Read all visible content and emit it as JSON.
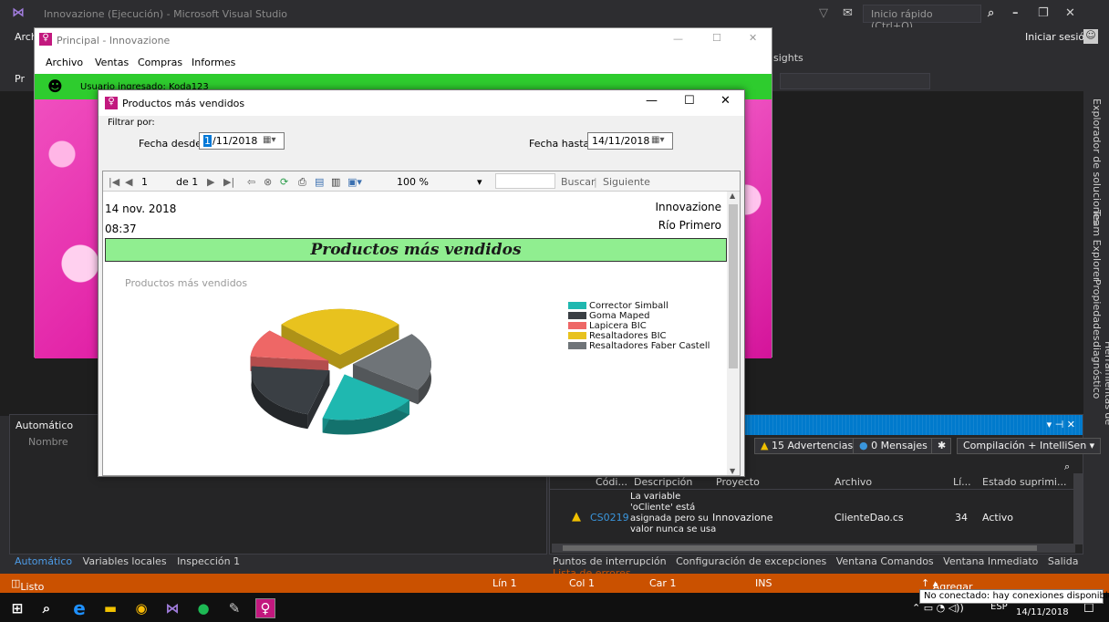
{
  "vs": {
    "title": "Innovazione (Ejecución) - Microsoft Visual Studio",
    "quick_launch": "Inicio rápido (Ctrl+Q)",
    "menu_partial": "Arch",
    "toolbar_partial": "Pr",
    "sign_in": "Iniciar sesión",
    "insights": "sights",
    "right_rail": [
      "Explorador de soluciones",
      "Team Explorer",
      "Propiedades",
      "Herramientas de diagnóstico"
    ]
  },
  "auto_panel": {
    "title": "Automático",
    "column": "Nombre",
    "tabs": [
      "Automático",
      "Variables locales",
      "Inspección 1"
    ]
  },
  "error_list": {
    "warnings": "15 Advertencias",
    "messages": "0 Mensajes",
    "build": "Compilación + IntelliSen",
    "headers": [
      "Códi...",
      "Descripción",
      "Proyecto",
      "Archivo",
      "Lí...",
      "Estado suprimi..."
    ],
    "row": {
      "code": "CS0219",
      "description": [
        "La variable",
        "'oCliente' está",
        "asignada pero su",
        "valor nunca se usa"
      ],
      "project": "Innovazione",
      "file": "ClienteDao.cs",
      "line": "34",
      "state": "Activo"
    }
  },
  "bottom_tabs": [
    "Puntos de interrupción",
    "Configuración de excepciones",
    "Ventana Comandos",
    "Ventana Inmediato",
    "Salida",
    "Lista de errores"
  ],
  "status": {
    "ready": "Listo",
    "line": "Lín 1",
    "col": "Col 1",
    "car": "Car 1",
    "ins": "INS",
    "source_control": "Agregar al control de código fuente",
    "tooltip": "No conectado: hay conexiones disponibles"
  },
  "taskbar": {
    "lang": "ESP",
    "date": "14/11/2018"
  },
  "principal": {
    "title": "Principal - Innovazione",
    "menu": [
      "Archivo",
      "Ventas",
      "Compras",
      "Informes"
    ],
    "user_label": "Usuario ingresado: Koda123"
  },
  "dialog": {
    "title": "Productos más vendidos",
    "filter_label": "Filtrar por:",
    "from_label": "Fecha desde:",
    "from_value": "14/11/2018",
    "from_shown": "/11/2018",
    "to_label": "Fecha hasta:",
    "to_value": "14/11/2018"
  },
  "viewer_toolbar": {
    "page": "1",
    "of": "de 1",
    "zoom": "100 %",
    "search": "Buscar",
    "next": "Siguiente"
  },
  "report": {
    "date": "14 nov. 2018",
    "time": "08:37",
    "org": "Innovazione",
    "address": "Río Primero",
    "banner": "Productos más vendidos"
  },
  "colors": {
    "vs_accent": "#007acc",
    "status_bar": "#ca5100",
    "user_bar": "#2ecc2e",
    "banner": "#90ee90"
  },
  "chart_data": {
    "type": "pie",
    "title": "Productos más vendidos",
    "legend_position": "right",
    "categories": [
      "Corrector Simball",
      "Goma Maped",
      "Lapicera BIC",
      "Resaltadores BIC",
      "Resaltadores Faber Castell"
    ],
    "values": [
      20,
      22,
      10,
      27,
      21
    ],
    "colors": [
      "#1fb8b0",
      "#3a3f44",
      "#ee6766",
      "#e8c21e",
      "#6f7478"
    ]
  }
}
